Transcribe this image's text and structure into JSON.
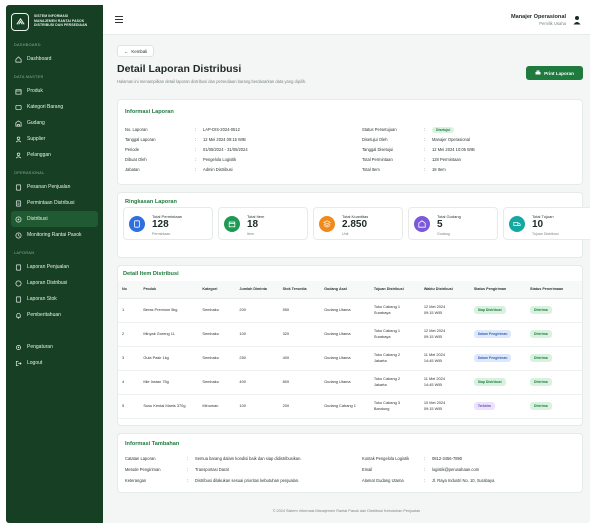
{
  "brand": {
    "line1": "SISTEM INFORMASI",
    "line2": "MANAJEMEN RANTAI PASOK",
    "line3": "DISTRIBUSI DAN PERSEDIAAN"
  },
  "sidebar": {
    "sections": [
      {
        "title": "DASHBOARD",
        "items": [
          {
            "label": "Dashboard",
            "icon": "home-icon"
          }
        ]
      },
      {
        "title": "DATA MASTER",
        "items": [
          {
            "label": "Produk",
            "icon": "box-icon"
          },
          {
            "label": "Kategori Barang",
            "icon": "tag-icon"
          },
          {
            "label": "Gudang",
            "icon": "warehouse-icon"
          },
          {
            "label": "Supplier",
            "icon": "users-icon"
          },
          {
            "label": "Pelanggan",
            "icon": "user-icon"
          }
        ]
      },
      {
        "title": "OPERASIONAL",
        "items": [
          {
            "label": "Pesanan Penjualan",
            "icon": "cart-icon"
          },
          {
            "label": "Permintaan Distribusi",
            "icon": "clipboard-icon"
          },
          {
            "label": "Distribusi",
            "icon": "truck-icon"
          },
          {
            "label": "Monitoring Rantai Pasok",
            "icon": "monitor-icon"
          }
        ]
      },
      {
        "title": "LAPORAN",
        "items": [
          {
            "label": "Laporan Penjualan",
            "icon": "report-icon"
          },
          {
            "label": "Laporan Distribusi",
            "icon": "report-icon"
          },
          {
            "label": "Laporan Stok",
            "icon": "report-icon"
          },
          {
            "label": "Pemberitahuan",
            "icon": "bell-icon"
          }
        ]
      }
    ],
    "bottom": [
      {
        "label": "Pengaturan",
        "icon": "gear-icon"
      },
      {
        "label": "Logout",
        "icon": "logout-icon"
      }
    ]
  },
  "topbar": {
    "user_name": "Manajer Operasional",
    "user_role": "Pemilik Usaha"
  },
  "page": {
    "back_label": "Kembali",
    "title": "Detail Laporan Distribusi",
    "subtitle": "Halaman ini menampilkan detail laporan distribusi dan persediaan barang berdasarkan data yang dipilih.",
    "print_label": "Print Laporan"
  },
  "info": {
    "title": "Informasi Laporan",
    "left": [
      {
        "k": "No. Laporan",
        "v": "LAP-DIS-2024-0512"
      },
      {
        "k": "Tanggal Laporan",
        "v": "12 Mei 2024 09:15 WIB"
      },
      {
        "k": "Periode",
        "v": "01/05/2024 - 31/05/2024"
      },
      {
        "k": "Dibuat Oleh",
        "v": "Pengelola Logistik"
      },
      {
        "k": "Jabatan",
        "v": "Admin Distribusi"
      }
    ],
    "right": [
      {
        "k": "Status Persetujuan",
        "v": "Disetujui",
        "badge": "green"
      },
      {
        "k": "Disetujui Oleh",
        "v": "Manajer Operasional"
      },
      {
        "k": "Tanggal Disetujui",
        "v": "12 Mei 2024 10:05 WIB"
      },
      {
        "k": "Total Permintaan",
        "v": "128 Permintaan"
      },
      {
        "k": "Total Item",
        "v": "18 Item"
      }
    ]
  },
  "summary": {
    "title": "Ringkasan Laporan",
    "stats": [
      {
        "label": "Total Permintaan",
        "value": "128",
        "unit": "Permintaan",
        "color": "#2f6fe0",
        "icon": "clipboard-icon"
      },
      {
        "label": "Total Item",
        "value": "18",
        "unit": "Item",
        "color": "#1f9a55",
        "icon": "box-icon"
      },
      {
        "label": "Total Kuantitas",
        "value": "2.850",
        "unit": "Unit",
        "color": "#f08a1c",
        "icon": "layers-icon"
      },
      {
        "label": "Total Gudang",
        "value": "5",
        "unit": "Gudang",
        "color": "#7b5ad9",
        "icon": "warehouse-icon"
      },
      {
        "label": "Total Tujuan",
        "value": "10",
        "unit": "Tujuan Distribusi",
        "color": "#14a8a0",
        "icon": "truck-icon"
      }
    ]
  },
  "table": {
    "title": "Detail Item Distribusi",
    "headers": [
      "No",
      "Produk",
      "Kategori",
      "Jumlah Diminta",
      "Stok Tersedia",
      "Gudang Asal",
      "Tujuan Distribusi",
      "Waktu Distribusi",
      "Status Pengiriman",
      "Status Penerimaan"
    ],
    "rows": [
      {
        "no": "1",
        "produk": "Beras Premium 5kg",
        "kategori": "Sembako",
        "diminta": "200",
        "stok": "550",
        "gudang": "Gudang Utama",
        "tujuan1": "Toko Cabang 1",
        "tujuan2": "Surabaya",
        "waktu1": "12 Mei 2024",
        "waktu2": "09:15 WIB",
        "kirim": "Siap Distribusi",
        "kirim_c": "green",
        "terima": "Diterima"
      },
      {
        "no": "2",
        "produk": "Minyak Goreng 1L",
        "kategori": "Sembako",
        "diminta": "100",
        "stok": "320",
        "gudang": "Gudang Utama",
        "tujuan1": "Toko Cabang 1",
        "tujuan2": "Surabaya",
        "waktu1": "12 Mei 2024",
        "waktu2": "09:15 WIB",
        "kirim": "Dalam Pengiriman",
        "kirim_c": "blue",
        "terima": "Diterima"
      },
      {
        "no": "3",
        "produk": "Gula Pasir 1kg",
        "kategori": "Sembako",
        "diminta": "250",
        "stok": "400",
        "gudang": "Gudang Utama",
        "tujuan1": "Toko Cabang 2",
        "tujuan2": "Jakarta",
        "waktu1": "11 Mei 2024",
        "waktu2": "14:45 WIB",
        "kirim": "Dalam Pengiriman",
        "kirim_c": "blue",
        "terima": "Diterima"
      },
      {
        "no": "4",
        "produk": "Mie Instan 75g",
        "kategori": "Sembako",
        "diminta": "400",
        "stok": "800",
        "gudang": "Gudang Utama",
        "tujuan1": "Toko Cabang 2",
        "tujuan2": "Jakarta",
        "waktu1": "11 Mei 2024",
        "waktu2": "14:45 WIB",
        "kirim": "Siap Distribusi",
        "kirim_c": "green",
        "terima": "Diterima"
      },
      {
        "no": "5",
        "produk": "Susu Kental Manis 370g",
        "kategori": "Minuman",
        "diminta": "100",
        "stok": "200",
        "gudang": "Gudang Cabang 1",
        "tujuan1": "Toko Cabang 3",
        "tujuan2": "Bandung",
        "waktu1": "10 Mei 2024",
        "waktu2": "09:15 WIB",
        "kirim": "Terkirim",
        "kirim_c": "purple",
        "terima": "Diterima"
      }
    ]
  },
  "extra": {
    "title": "Informasi Tambahan",
    "left": [
      {
        "k": "Catatan Laporan",
        "v": "Semua barang dalam kondisi baik dan siap didistribusikan."
      },
      {
        "k": "Metode Pengiriman",
        "v": "Transportasi Darat"
      },
      {
        "k": "Keterangan",
        "v": "Distribusi dilakukan sesuai prioritas kebutuhan penjualan."
      }
    ],
    "right": [
      {
        "k": "Kontak Pengelola Logistik",
        "v": "0812-3456-7890"
      },
      {
        "k": "Email",
        "v": "logistik@perusahaan.com"
      },
      {
        "k": "Alamat Gudang Utama",
        "v": "Jl. Raya Industri No. 10, Surabaya"
      }
    ]
  },
  "footer": "© 2024 Sistem Informasi Manajemen Rantai Pasok dan Distribusi Kebutuhan Penjualan"
}
